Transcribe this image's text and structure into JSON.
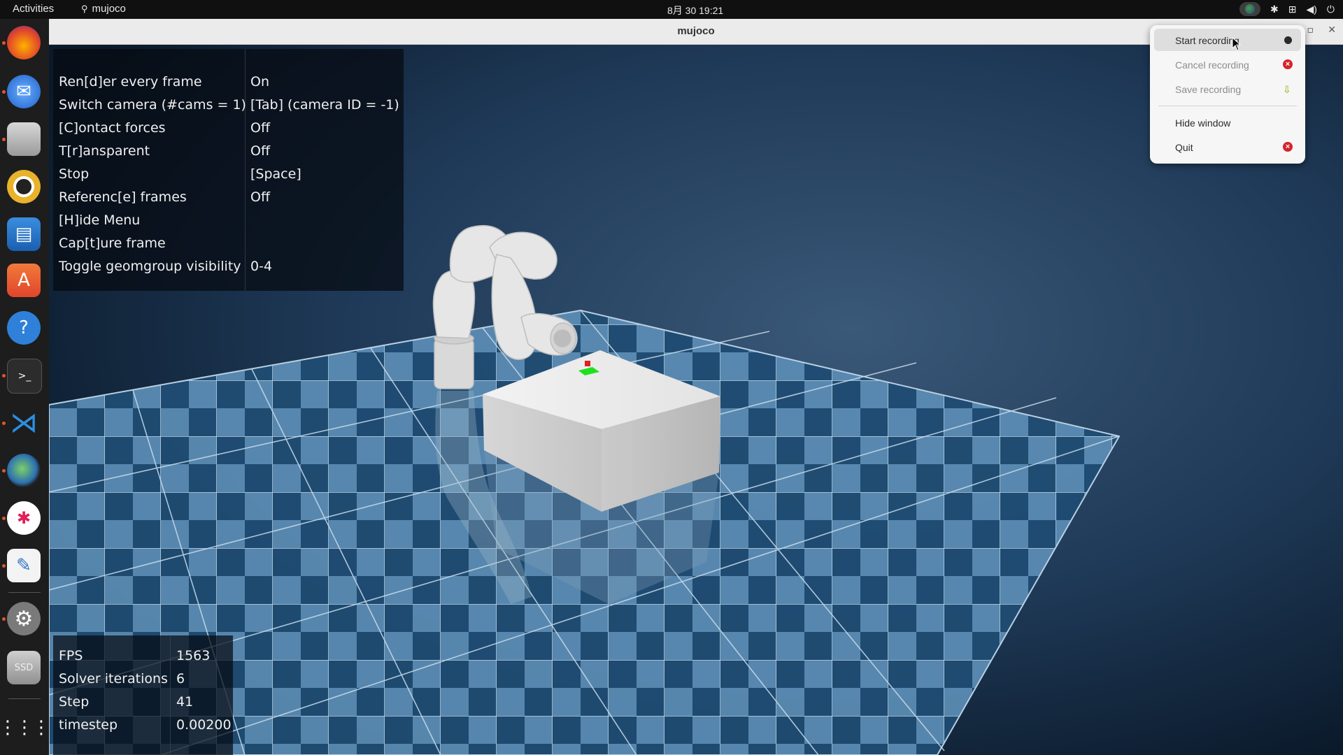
{
  "topbar": {
    "activities": "Activities",
    "app_name": "mujoco",
    "clock": "8月 30  19:21",
    "tray_icons": [
      "chrome-indicator-icon",
      "slack-indicator-icon",
      "network-icon",
      "volume-icon",
      "power-icon"
    ]
  },
  "dock": {
    "items": [
      "firefox-icon",
      "thunderbird-icon",
      "files-icon",
      "rhythmbox-icon",
      "writer-icon",
      "app-center-icon",
      "help-icon",
      "terminal-icon",
      "vscode-icon",
      "chrome-icon",
      "slack-icon",
      "text-editor-icon",
      "settings-icon",
      "ssd-icon",
      "show-apps-icon"
    ],
    "ssd_label": "SSD"
  },
  "window": {
    "title": "mujoco"
  },
  "options_panel": {
    "rows": [
      {
        "key": "Ren[d]er every frame",
        "value": "On"
      },
      {
        "key": "Switch camera (#cams = 1)",
        "value": "[Tab] (camera ID = -1)"
      },
      {
        "key": "[C]ontact forces",
        "value": "Off"
      },
      {
        "key": "T[r]ansparent",
        "value": "Off"
      },
      {
        "key": "Stop",
        "value": "[Space]"
      },
      {
        "key": "Referenc[e] frames",
        "value": "Off"
      },
      {
        "key": "[H]ide Menu",
        "value": ""
      },
      {
        "key": "Cap[t]ure frame",
        "value": ""
      },
      {
        "key": "Toggle geomgroup visibility",
        "value": "0-4"
      }
    ]
  },
  "stats_panel": {
    "rows": [
      {
        "key": "FPS",
        "value": "1563"
      },
      {
        "key": "Solver iterations",
        "value": "6"
      },
      {
        "key": "Step",
        "value": "41"
      },
      {
        "key": "timestep",
        "value": "0.00200"
      }
    ]
  },
  "menu": {
    "start_recording": "Start recording",
    "cancel_recording": "Cancel recording",
    "save_recording": "Save recording",
    "hide_window": "Hide window",
    "quit": "Quit"
  },
  "colors": {
    "accent_red": "#d6232b",
    "floor_dark": "#1f4c73",
    "floor_light": "#5f8fb5"
  }
}
